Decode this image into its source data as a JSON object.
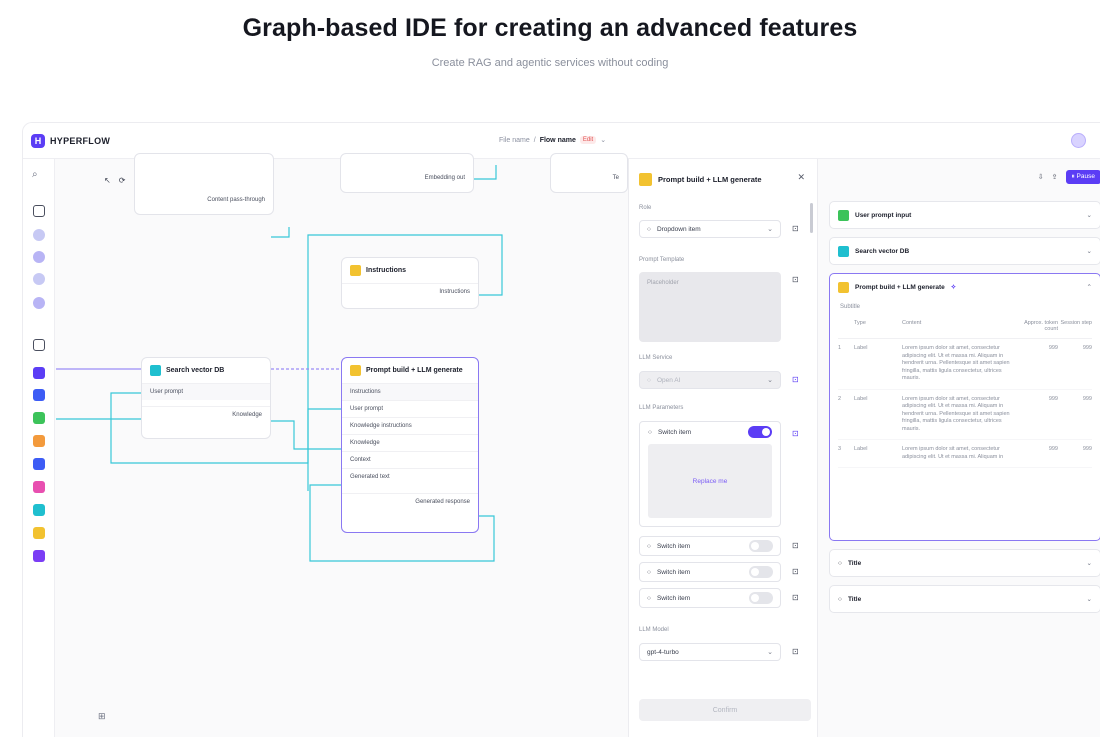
{
  "hero": {
    "title": "Graph-based IDE for creating an advanced features",
    "subtitle": "Create RAG and agentic services without coding"
  },
  "topbar": {
    "logo_text": "HYPERFLOW",
    "file_name": "File name",
    "separator": "/",
    "flow_name": "Flow name",
    "status_badge": "Edit",
    "chevron": "⌄"
  },
  "colors": {
    "accent": "#5b3df5",
    "green": "#3cc35a",
    "cyan": "#1fbfcf",
    "yellow": "#f2c230",
    "orange": "#f39a3c",
    "blue": "#3d5cf5",
    "pink": "#e84fb0",
    "wire_cyan": "#38c7d8",
    "wire_purple": "#9b8cf5"
  },
  "canvas": {
    "toolbar": {
      "select": "↖",
      "history": "⟳",
      "grid": "▦",
      "undo": "↶",
      "redo": "↷",
      "zoom": "⊕",
      "fit": "⊻",
      "close": "✕",
      "more": "⋮",
      "branch": "⑂"
    },
    "nodes": {
      "top_left": {
        "row": "Content pass-through"
      },
      "top_mid": {
        "row": "Embedding out"
      },
      "top_right": {
        "row": "Te"
      },
      "instructions": {
        "title": "Instructions",
        "row": "Instructions"
      },
      "search": {
        "title": "Search vector DB",
        "row1": "User prompt",
        "row2": "Knowledge"
      },
      "prompt": {
        "title": "Prompt build + LLM generate",
        "rows": [
          "Instructions",
          "User prompt",
          "Knowledge instructions",
          "Knowledge",
          "Context",
          "Generated text"
        ],
        "output": "Generated response"
      }
    },
    "bottom_icon": "⊞"
  },
  "panel": {
    "title": "Prompt build + LLM generate",
    "close": "✕",
    "role_label": "Role",
    "role_value": "Dropdown item",
    "prompt_template_label": "Prompt Template",
    "prompt_placeholder": "Placeholder",
    "llm_service_label": "LLM Service",
    "llm_service_value": "Open AI",
    "llm_params_label": "LLM Parameters",
    "switch_item": "Switch item",
    "replace_me": "Replace me",
    "llm_model_label": "LLM Model",
    "llm_model_value": "gpt-4-turbo",
    "confirm": "Confirm",
    "caret": "⌄",
    "lock": "🔒"
  },
  "right": {
    "tools": {
      "a": "⇩",
      "b": "⇪",
      "pause": "⏸ Pause"
    },
    "items": {
      "user_prompt": "User prompt input",
      "search": "Search vector DB",
      "prompt": "Prompt build + LLM generate",
      "title1": "Title",
      "title2": "Title"
    },
    "subtitle": "Subtitle",
    "table": {
      "headers": [
        "Type",
        "Content",
        "Approx. token count",
        "Session step"
      ],
      "rows": [
        {
          "n": "1",
          "type": "Label",
          "content": "Lorem ipsum dolor sit amet, consectetur adipiscing elit. Ut et massa mi. Aliquam in hendrerit urna. Pellentesque sit amet sapien fringilla, mattis ligula consectetur, ultrices mauris.",
          "tokens": "999",
          "step": "999"
        },
        {
          "n": "2",
          "type": "Label",
          "content": "Lorem ipsum dolor sit amet, consectetur adipiscing elit. Ut et massa mi. Aliquam in hendrerit urna. Pellentesque sit amet sapien fringilla, mattis ligula consectetur, ultrices mauris.",
          "tokens": "999",
          "step": "999"
        },
        {
          "n": "3",
          "type": "Label",
          "content": "Lorem ipsum dolor sit amet, consectetur adipiscing elit. Ut et massa mi. Aliquam in",
          "tokens": "999",
          "step": "999"
        }
      ]
    },
    "chevron_down": "⌄",
    "sparkle": "✧"
  }
}
